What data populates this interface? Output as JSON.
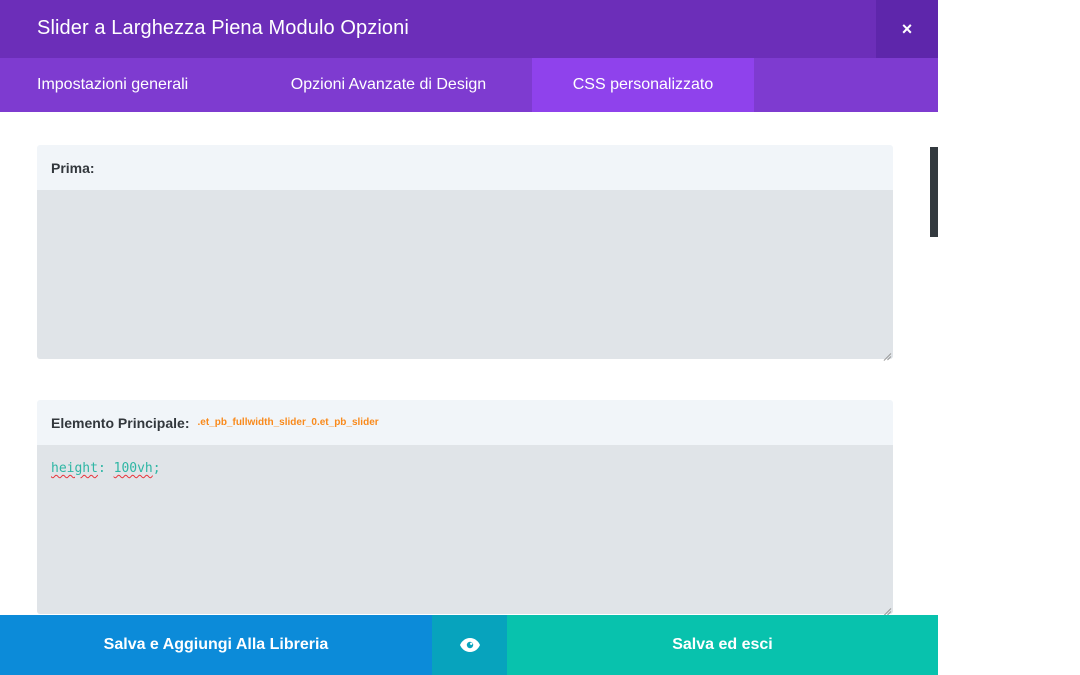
{
  "modal": {
    "title": "Slider a Larghezza Piena Modulo Opzioni",
    "close_label": "×"
  },
  "tabs": [
    {
      "label": "Impostazioni generali",
      "active": false
    },
    {
      "label": "Opzioni Avanzate di Design",
      "active": false
    },
    {
      "label": "CSS personalizzato",
      "active": true
    }
  ],
  "fields": [
    {
      "label": "Prima:",
      "selector": "",
      "value": ""
    },
    {
      "label": "Elemento Principale:",
      "selector": ".et_pb_fullwidth_slider_0.et_pb_slider",
      "value_prop": "height",
      "value_sep": ": ",
      "value_val": "100vh",
      "value_end": ";"
    }
  ],
  "footer": {
    "library_label": "Salva e Aggiungi Alla Libreria",
    "preview_icon": "eye-icon",
    "save_label": "Salva ed esci"
  },
  "colors": {
    "title_bar": "#6c2eb9",
    "tabs_bar": "#7e3bd0",
    "active_tab": "#8f42ec",
    "library_button": "#0c8bd9",
    "preview_button": "#07a3bd",
    "save_button": "#08c2ad",
    "selector_text": "#f98a1c",
    "code_text": "#2eb6a4"
  }
}
